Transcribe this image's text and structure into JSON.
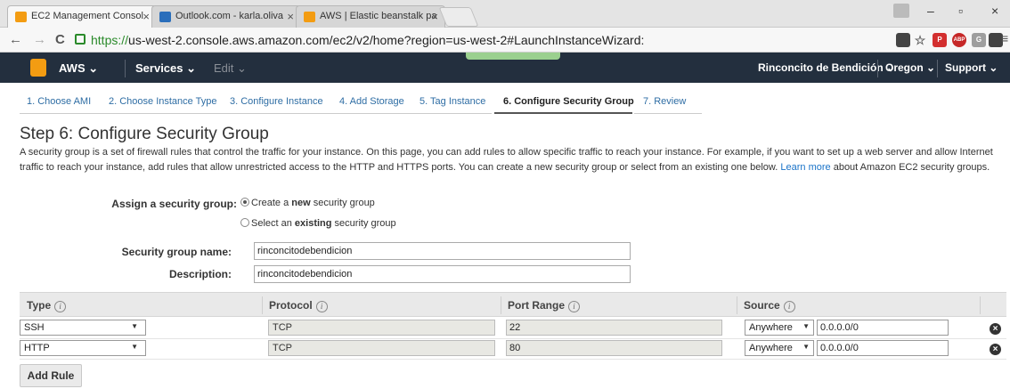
{
  "browser": {
    "tabs": [
      {
        "title": "EC2 Management Consol",
        "favicon_color": "#f39c12"
      },
      {
        "title": "Outlook.com - karla.oliva",
        "favicon_color": "#2a6ebb"
      },
      {
        "title": "AWS | Elastic beanstalk pa",
        "favicon_color": "#f39c12"
      }
    ],
    "tab_close": "×",
    "url_https": "https://",
    "url_rest": "us-west-2.console.aws.amazon.com/ec2/v2/home?region=us-west-2#LaunchInstanceWizard:",
    "back": "←",
    "forward": "→",
    "reload": "C",
    "minimize": "–",
    "maximize": "▫",
    "close": "×",
    "extensions": [
      {
        "label": "",
        "color": "#444"
      },
      {
        "label": "☆",
        "color": "#fff"
      },
      {
        "label": "P",
        "color": "#d32f2f"
      },
      {
        "label": "ABP",
        "color": "#c62828"
      },
      {
        "label": "G",
        "color": "#9e9e9e"
      },
      {
        "label": "",
        "color": "#424242"
      },
      {
        "label": "≡",
        "color": "#fff"
      }
    ]
  },
  "aws_nav": {
    "brand": "AWS ⌄",
    "services": "Services ⌄",
    "edit": "Edit ⌄",
    "account": "Rinconcito de Bendición ⌄",
    "region": "Oregon ⌄",
    "support": "Support ⌄"
  },
  "steps": [
    "1. Choose AMI",
    "2. Choose Instance Type",
    "3. Configure Instance",
    "4. Add Storage",
    "5. Tag Instance",
    "6. Configure Security Group",
    "7. Review"
  ],
  "page": {
    "title": "Step 6: Configure Security Group",
    "description": "A security group is a set of firewall rules that control the traffic for your instance. On this page, you can add rules to allow specific traffic to reach your instance. For example, if you want to set up a web server and allow Internet traffic to reach your instance, add rules that allow unrestricted access to the HTTP and HTTPS ports. You can create a new security group or select from an existing one below.",
    "learn_more": "Learn more",
    "description_end": "about Amazon EC2 security groups."
  },
  "form": {
    "assign_label": "Assign a security group:",
    "option_new_pre": "Create a ",
    "option_new_bold": "new",
    "option_new_post": " security group",
    "option_existing_pre": "Select an ",
    "option_existing_bold": "existing",
    "option_existing_post": " security group",
    "name_label": "Security group name:",
    "name_value": "rinconcitodebendicion",
    "desc_label": "Description:",
    "desc_value": "rinconcitodebendicion"
  },
  "rules_table": {
    "headers": [
      "Type",
      "Protocol",
      "Port Range",
      "Source"
    ],
    "info": "i",
    "rows": [
      {
        "type": "SSH",
        "protocol": "TCP",
        "port": "22",
        "source": "Anywhere",
        "cidr": "0.0.0.0/0"
      },
      {
        "type": "HTTP",
        "protocol": "TCP",
        "port": "80",
        "source": "Anywhere",
        "cidr": "0.0.0.0/0"
      }
    ],
    "arrow": "▼",
    "remove": "×"
  },
  "add_rule": "Add Rule"
}
